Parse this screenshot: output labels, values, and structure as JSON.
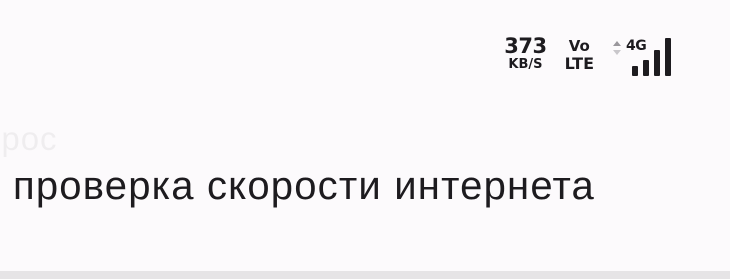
{
  "status_bar": {
    "net_speed_value": "373",
    "net_speed_unit": "KB/S",
    "volte_top": "Vo",
    "volte_bottom": "LTE",
    "network_type": "4G",
    "signal_level": 1.0,
    "icons": [
      "data-arrows-icon",
      "signal-bars-icon"
    ]
  },
  "ghost_title": "opoc",
  "title": "проверка скорости интернета"
}
